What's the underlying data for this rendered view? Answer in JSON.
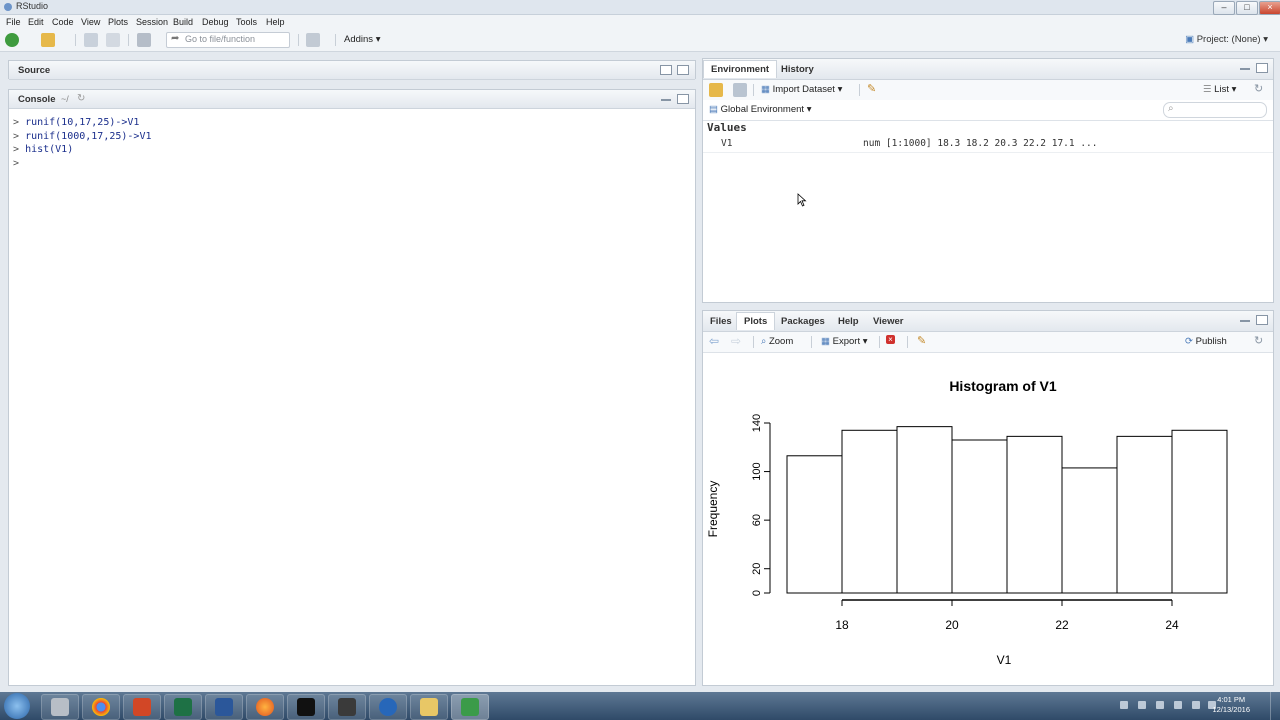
{
  "window": {
    "title": "RStudio"
  },
  "menu": [
    "File",
    "Edit",
    "Code",
    "View",
    "Plots",
    "Session",
    "Build",
    "Debug",
    "Tools",
    "Help"
  ],
  "toolbar": {
    "goto_placeholder": "Go to file/function",
    "addins_label": "Addins",
    "project_label": "Project: (None)"
  },
  "source": {
    "label": "Source"
  },
  "console": {
    "label": "Console",
    "path": "~/",
    "lines": [
      "runif(10,17,25)->V1",
      "runif(1000,17,25)->V1",
      "hist(V1)"
    ],
    "prompt": ">"
  },
  "environment": {
    "tabs": [
      "Environment",
      "History"
    ],
    "import_label": "Import Dataset",
    "list_label": "List",
    "scope_label": "Global Environment",
    "section": "Values",
    "rows": [
      {
        "name": "V1",
        "value": "num [1:1000] 18.3 18.2 20.3 22.2 17.1 ..."
      }
    ]
  },
  "files_pane": {
    "tabs": [
      "Files",
      "Plots",
      "Packages",
      "Help",
      "Viewer"
    ],
    "zoom_label": "Zoom",
    "export_label": "Export",
    "publish_label": "Publish"
  },
  "chart_data": {
    "type": "bar",
    "title": "Histogram of V1",
    "xlabel": "V1",
    "ylabel": "Frequency",
    "bin_edges": [
      17,
      18,
      19,
      20,
      21,
      22,
      23,
      24,
      25
    ],
    "values": [
      113,
      134,
      137,
      126,
      129,
      103,
      129,
      134
    ],
    "xticks": [
      18,
      20,
      22,
      24
    ],
    "yticks": [
      0,
      20,
      60,
      100,
      140
    ],
    "ylim": [
      0,
      140
    ],
    "xlim": [
      16.2,
      25.8
    ],
    "grid": false
  },
  "taskbar": {
    "clock_time": "4:01 PM",
    "clock_date": "12/13/2016"
  },
  "colors": {
    "accent": "#4a7ab8",
    "chrome": "#e4e9ef",
    "console_text": "#1b2f8c"
  }
}
